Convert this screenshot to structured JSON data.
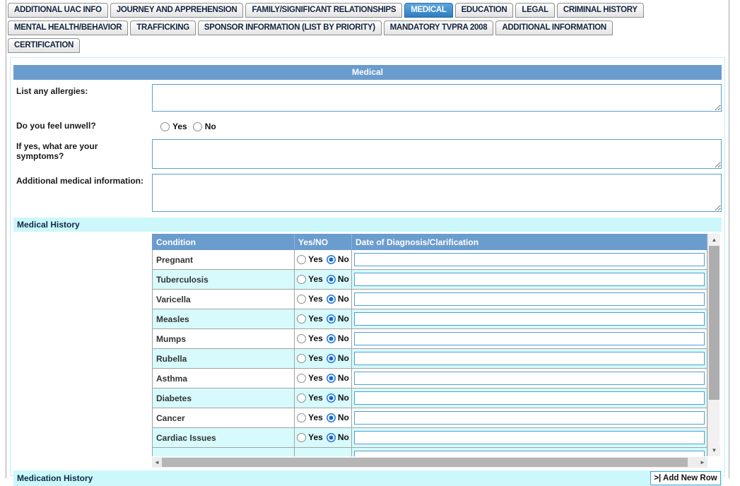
{
  "tabs": [
    {
      "label": "ADDITIONAL UAC INFO",
      "active": false
    },
    {
      "label": "JOURNEY AND APPREHENSION",
      "active": false
    },
    {
      "label": "FAMILY/SIGNIFICANT RELATIONSHIPS",
      "active": false
    },
    {
      "label": "MEDICAL",
      "active": true
    },
    {
      "label": "EDUCATION",
      "active": false
    },
    {
      "label": "LEGAL",
      "active": false
    },
    {
      "label": "CRIMINAL HISTORY",
      "active": false,
      "break_after": true
    },
    {
      "label": "MENTAL HEALTH/BEHAVIOR",
      "active": false
    },
    {
      "label": "TRAFFICKING",
      "active": false
    },
    {
      "label": "SPONSOR INFORMATION (LIST BY PRIORITY)",
      "active": false
    },
    {
      "label": "MANDATORY TVPRA 2008",
      "active": false
    },
    {
      "label": "ADDITIONAL INFORMATION",
      "active": false,
      "break_after": true
    },
    {
      "label": "CERTIFICATION",
      "active": false
    }
  ],
  "panel": {
    "title": "Medical",
    "fields": {
      "allergies_label": "List any allergies:",
      "allergies_value": "",
      "unwell_label": "Do you feel unwell?",
      "unwell_selected": "",
      "symptoms_label": "If yes, what are your symptoms?",
      "symptoms_value": "",
      "additional_label": "Additional medical information:",
      "additional_value": "",
      "yes_label": "Yes",
      "no_label": "No"
    },
    "sections": {
      "medical_history": "Medical History",
      "medication_history": "Medication History"
    },
    "table": {
      "headers": [
        "Condition",
        "Yes/NO",
        "Date of Diagnosis/Clarification"
      ],
      "rows": [
        {
          "condition": "Pregnant",
          "yes": false,
          "no": true,
          "date": ""
        },
        {
          "condition": "Tuberculosis",
          "yes": false,
          "no": true,
          "date": ""
        },
        {
          "condition": "Varicella",
          "yes": false,
          "no": true,
          "date": ""
        },
        {
          "condition": "Measles",
          "yes": false,
          "no": true,
          "date": ""
        },
        {
          "condition": "Mumps",
          "yes": false,
          "no": true,
          "date": ""
        },
        {
          "condition": "Rubella",
          "yes": false,
          "no": true,
          "date": ""
        },
        {
          "condition": "Asthma",
          "yes": false,
          "no": true,
          "date": ""
        },
        {
          "condition": "Diabetes",
          "yes": false,
          "no": true,
          "date": ""
        },
        {
          "condition": "Cancer",
          "yes": false,
          "no": true,
          "date": ""
        },
        {
          "condition": "Cardiac Issues",
          "yes": false,
          "no": true,
          "date": ""
        }
      ]
    },
    "add_row_button": ">| Add New Row"
  },
  "colors": {
    "header_blue": "#6B9CCE",
    "active_tab_blue": "#2F7CC0",
    "section_cyan": "#CCF7FB",
    "alt_row_cyan": "#D7FAFC",
    "input_border_blue": "#4E9FD4"
  },
  "scrollbar": {
    "up_icon": "▲",
    "down_icon": "▼",
    "left_icon": "◄",
    "right_icon": "►"
  }
}
